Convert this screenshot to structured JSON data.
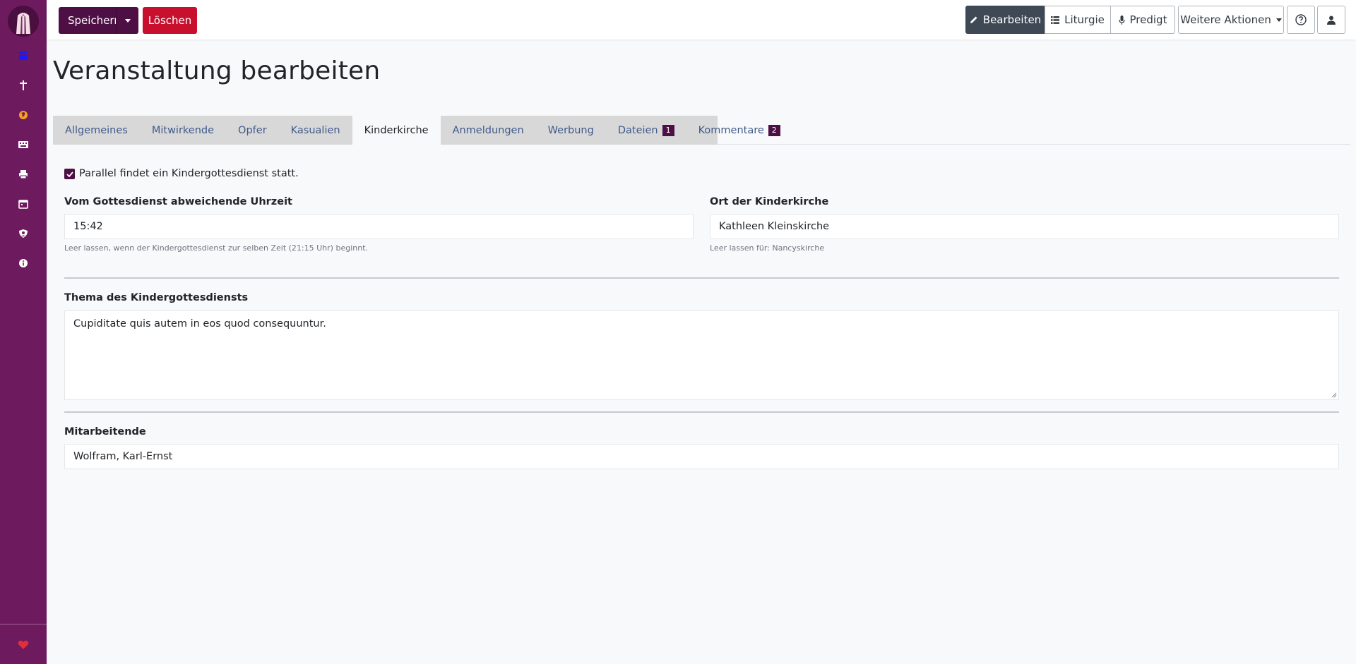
{
  "toolbar": {
    "save_label": "Speichern",
    "delete_label": "Löschen",
    "edit_label": "Bearbeiten",
    "liturgy_label": "Liturgie",
    "sermon_label": "Predigt",
    "more_label": "Weitere Aktionen"
  },
  "sidebar": {
    "items": [
      {
        "icon": "calendar-icon",
        "color": "#1a1aff"
      },
      {
        "icon": "cross-icon",
        "color": "#ffffff"
      },
      {
        "icon": "globe-icon",
        "color": "#f7a21b"
      },
      {
        "icon": "keyboard-icon",
        "color": "#ffffff"
      },
      {
        "icon": "printer-icon",
        "color": "#ffffff"
      },
      {
        "icon": "calendar-alt-icon",
        "color": "#ffffff"
      },
      {
        "icon": "user-shield-icon",
        "color": "#ffffff"
      },
      {
        "icon": "info-icon",
        "color": "#ffffff"
      }
    ],
    "footer_icon": "heart-icon"
  },
  "page": {
    "title": "Veranstaltung bearbeiten"
  },
  "tabs": [
    {
      "label": "Allgemeines",
      "active": false
    },
    {
      "label": "Mitwirkende",
      "active": false
    },
    {
      "label": "Opfer",
      "active": false
    },
    {
      "label": "Kasualien",
      "active": false
    },
    {
      "label": "Kinderkirche",
      "active": true
    },
    {
      "label": "Anmeldungen",
      "active": false
    },
    {
      "label": "Werbung",
      "active": false
    },
    {
      "label": "Dateien",
      "badge": "1",
      "active": false
    },
    {
      "label": "Kommentare",
      "badge": "2",
      "active": false
    }
  ],
  "form": {
    "parallel_checkbox": {
      "label": "Parallel findet ein Kindergottesdienst statt.",
      "checked": true
    },
    "time": {
      "label": "Vom Gottesdienst abweichende Uhrzeit",
      "value": "15:42",
      "help": "Leer lassen, wenn der Kindergottesdienst zur selben Zeit (21:15 Uhr) beginnt."
    },
    "location": {
      "label": "Ort der Kinderkirche",
      "value": "Kathleen Kleinskirche",
      "help": "Leer lassen für: Nancyskirche"
    },
    "topic": {
      "label": "Thema des Kindergottesdiensts",
      "value": "Cupiditate quis autem in eos quod consequuntur."
    },
    "staff": {
      "label": "Mitarbeitende",
      "value": "Wolfram, Karl-Ernst"
    }
  },
  "colors": {
    "sidebar": "#6d1a5f",
    "primary": "#4d0f44",
    "danger": "#c8102e",
    "active_button": "#3f4955"
  }
}
